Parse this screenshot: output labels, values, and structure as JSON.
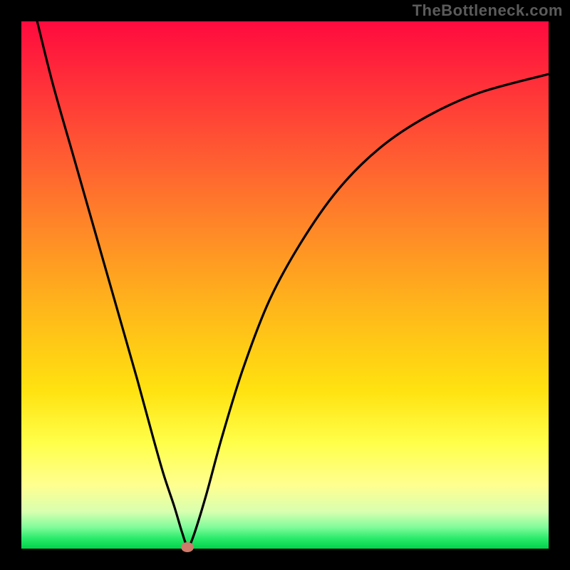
{
  "watermark": "TheBottleneck.com",
  "chart_data": {
    "type": "line",
    "title": "",
    "xlabel": "",
    "ylabel": "",
    "xlim": [
      0,
      100
    ],
    "ylim": [
      0,
      100
    ],
    "series": [
      {
        "name": "bottleneck-curve",
        "x": [
          3,
          6,
          10,
          14,
          18,
          22,
          25,
          27,
          29,
          30.5,
          31.5,
          32.5,
          35,
          38,
          42,
          47,
          53,
          60,
          68,
          77,
          87,
          100
        ],
        "values": [
          100,
          88,
          74,
          60,
          46,
          32,
          21,
          14,
          8,
          3,
          0.5,
          2,
          10,
          21,
          34,
          47,
          58,
          68,
          76,
          82,
          86.5,
          90
        ]
      }
    ],
    "min_point": {
      "x": 31.5,
      "y": 0.5
    },
    "colors": {
      "curve": "#000000",
      "dot": "#cf7a6b",
      "gradient_top": "#ff0a3e",
      "gradient_bottom": "#00d34a"
    }
  }
}
